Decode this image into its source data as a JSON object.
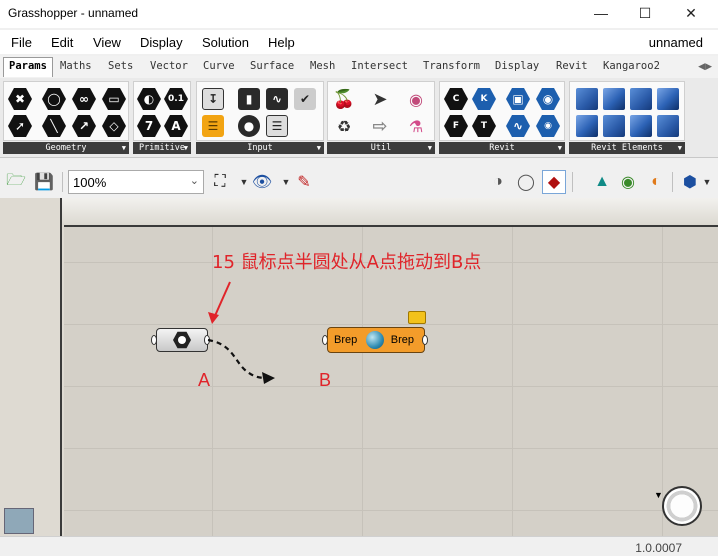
{
  "window": {
    "title": "Grasshopper - unnamed",
    "min_icon": "minimize-icon",
    "max_icon": "maximize-icon",
    "close_icon": "close-icon"
  },
  "menu": {
    "items": [
      "File",
      "Edit",
      "View",
      "Display",
      "Solution",
      "Help"
    ],
    "document_name": "unnamed"
  },
  "tabs": [
    "Params",
    "Maths",
    "Sets",
    "Vector",
    "Curve",
    "Surface",
    "Mesh",
    "Intersect",
    "Transform",
    "Display",
    "Revit",
    "Kangaroo2"
  ],
  "active_tab": "Params",
  "panels": [
    {
      "label": "Geometry"
    },
    {
      "label": "Primitive"
    },
    {
      "label": "Input"
    },
    {
      "label": "Util"
    },
    {
      "label": "Revit"
    },
    {
      "label": "Revit Elements"
    }
  ],
  "primitive_glyphs": {
    "seven": "7",
    "zero_one": "0.1",
    "letter_a": "A"
  },
  "toolbar": {
    "zoom": "100%"
  },
  "canvas": {
    "annotation": "15 鼠标点半圆处从A点拖动到B点",
    "label_a": "A",
    "label_b": "B",
    "brep_node": {
      "input": "Brep",
      "output": "Brep"
    }
  },
  "status": {
    "version": "1.0.0007"
  },
  "colors": {
    "accent": "#e0242a",
    "node_orange": "#f39c2a",
    "canvas": "#d4d0c8"
  }
}
